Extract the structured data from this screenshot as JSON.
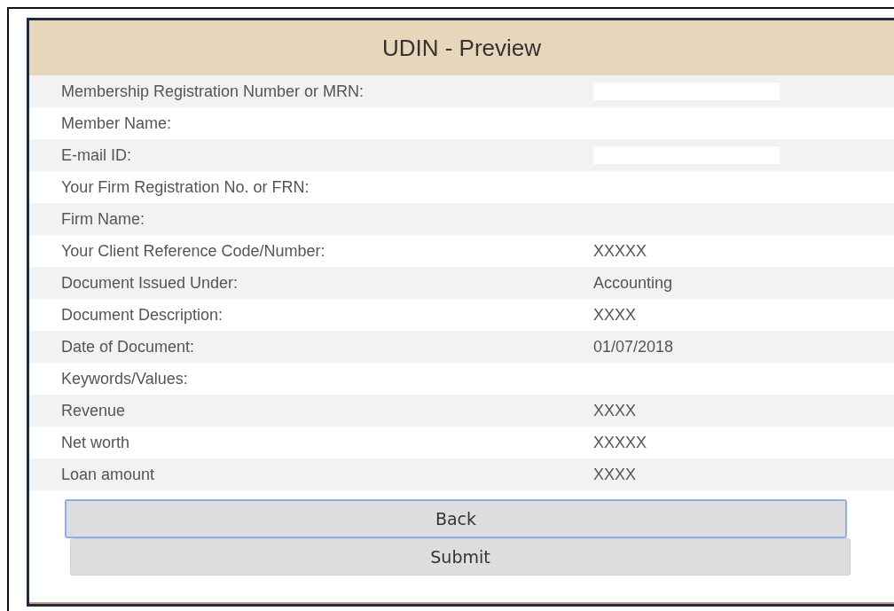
{
  "title": "UDIN - Preview",
  "rows": [
    {
      "label": "Membership Registration Number or MRN:",
      "value_hidden": true
    },
    {
      "label": "Member Name:"
    },
    {
      "label": "E-mail ID:",
      "value_hidden": true
    },
    {
      "label": "Your Firm Registration No. or FRN:"
    },
    {
      "label": "Firm Name:"
    },
    {
      "label": "Your Client Reference Code/Number:",
      "value": "XXXXX"
    },
    {
      "label": "Document Issued Under:",
      "value": "Accounting"
    },
    {
      "label": "Document Description:",
      "value": "XXXX"
    },
    {
      "label": "Date of Document:",
      "value": "01/07/2018"
    },
    {
      "label": "Keywords/Values:"
    },
    {
      "label": "Revenue",
      "value": "XXXX"
    },
    {
      "label": "Net worth",
      "value": "XXXXX"
    },
    {
      "label": "Loan amount",
      "value": "XXXX"
    }
  ],
  "buttons": [
    {
      "label": "Back",
      "focused": true
    },
    {
      "label": "Submit",
      "focused": false
    }
  ]
}
